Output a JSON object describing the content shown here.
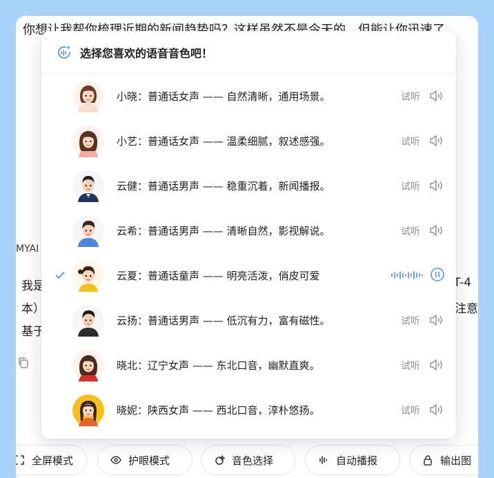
{
  "background": {
    "top_text": "你想让我帮你梳理近期的新闻趋势吗？这样虽然不是今天的，但能让你迅速了",
    "brand_fragment": "MYAI",
    "left_fragments": [
      "我是",
      "本）",
      "基于"
    ],
    "right_fragments": [
      "PT-4",
      "注意"
    ]
  },
  "bottom_bar": {
    "chips": [
      {
        "label": "全屏模式",
        "icon": "fullscreen-icon"
      },
      {
        "label": "护眼模式",
        "icon": "eye-icon"
      },
      {
        "label": "音色选择",
        "icon": "voice-style-icon"
      },
      {
        "label": "自动播报",
        "icon": "waveform-icon"
      },
      {
        "label": "输出图",
        "icon": "lock-icon"
      }
    ]
  },
  "popup": {
    "title": "选择您喜欢的语音音色吧！",
    "preview_label": "试听",
    "accent_color": "#4a90e2",
    "voices": [
      {
        "name": "小晓：普通话女声 —— 自然清晰，通用场景。",
        "selected": false,
        "avatar": "girl-short-hair"
      },
      {
        "name": "小艺：普通话女声 —— 温柔细腻，叙述感强。",
        "selected": false,
        "avatar": "girl-long-hair"
      },
      {
        "name": "云健：普通话男声 —— 稳重沉着，新闻播报。",
        "selected": false,
        "avatar": "man-suit"
      },
      {
        "name": "云希：普通话男声 —— 清晰自然，影视解说。",
        "selected": false,
        "avatar": "young-man-blue"
      },
      {
        "name": "云夏：普通话童声 —— 明亮活泼，俏皮可爱",
        "selected": true,
        "avatar": "child-yellow"
      },
      {
        "name": "云扬：普通话男声 —— 低沉有力，富有磁性。",
        "selected": false,
        "avatar": "man-black"
      },
      {
        "name": "晓北：辽宁女声 —— 东北口音，幽默直爽。",
        "selected": false,
        "avatar": "woman-red"
      },
      {
        "name": "晓妮：陕西女声 —— 西北口音，淳朴悠扬。",
        "selected": false,
        "avatar": "girl-braids-yellow-bg"
      }
    ]
  }
}
